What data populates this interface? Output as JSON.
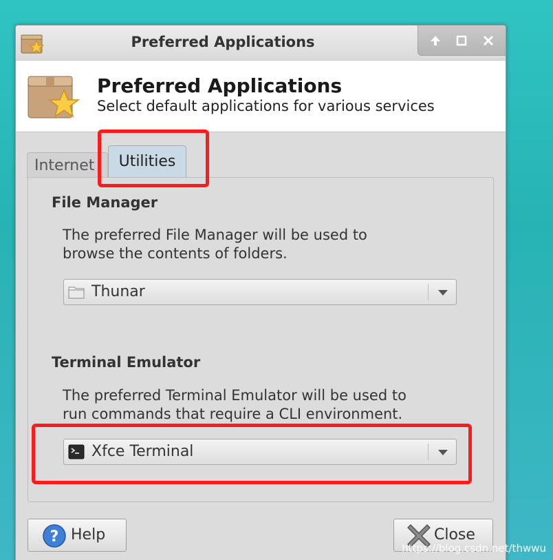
{
  "window": {
    "title": "Preferred Applications",
    "header_title": "Preferred Applications",
    "header_subtitle": "Select default applications for various services",
    "icon": "preferred-apps-box-star-icon"
  },
  "titlebar_buttons": [
    {
      "name": "shade-button",
      "icon": "arrow-up-icon"
    },
    {
      "name": "maximize-button",
      "icon": "maximize-icon"
    },
    {
      "name": "close-window-button",
      "icon": "close-icon"
    }
  ],
  "tabs": [
    {
      "label": "Internet",
      "active": false
    },
    {
      "label": "Utilities",
      "active": true
    }
  ],
  "file_manager": {
    "title": "File Manager",
    "description_line1": "The preferred File Manager will be used to",
    "description_line2": "browse the contents of folders.",
    "selected": "Thunar",
    "icon": "folder-icon"
  },
  "terminal": {
    "title": "Terminal Emulator",
    "description_line1": "The preferred Terminal Emulator will be used to",
    "description_line2": "run commands that require a CLI environment.",
    "selected": "Xfce Terminal",
    "icon": "terminal-icon"
  },
  "buttons": {
    "help": "Help",
    "close": "Close"
  },
  "annotations": {
    "highlight_color": "#ff1b1b"
  },
  "watermark": "https://blog.csdn.net/thwwu"
}
